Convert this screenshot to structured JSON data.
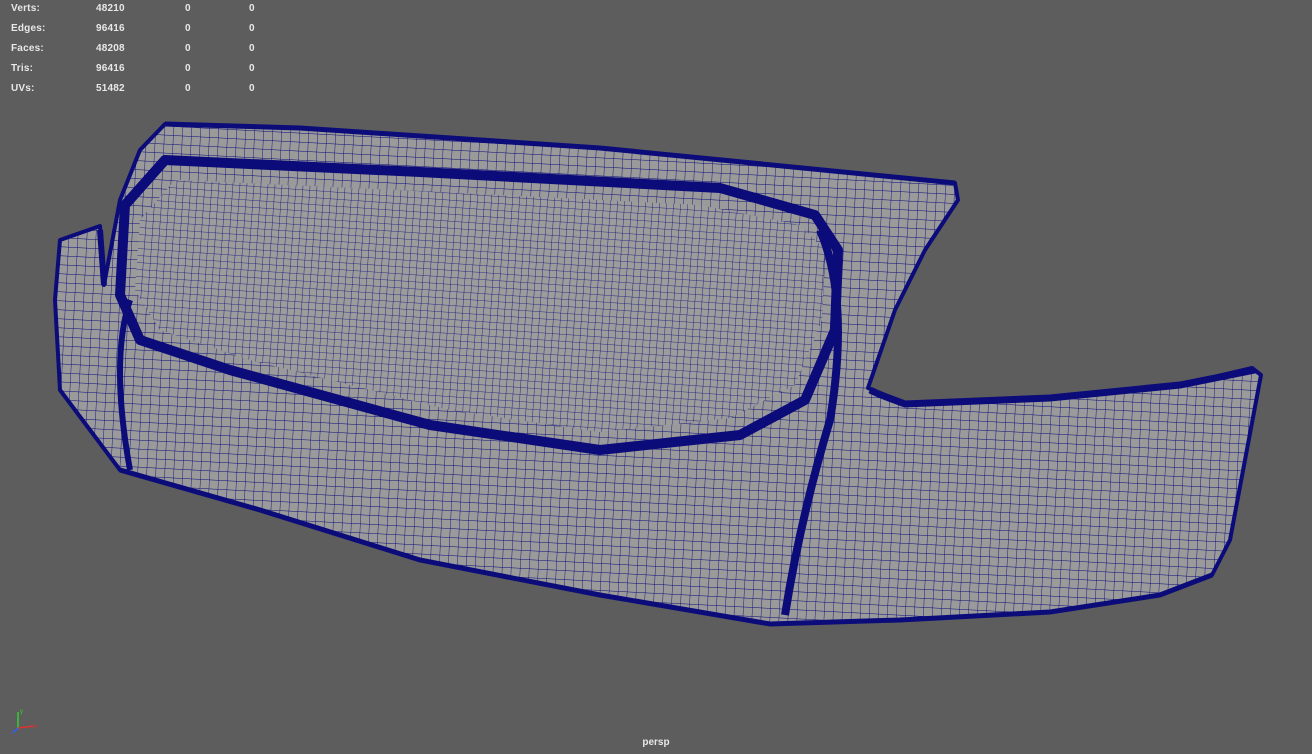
{
  "hud": {
    "rows": [
      {
        "label": "Verts:",
        "total": "48210",
        "selected": "0",
        "component": "0"
      },
      {
        "label": "Edges:",
        "total": "96416",
        "selected": "0",
        "component": "0"
      },
      {
        "label": "Faces:",
        "total": "48208",
        "selected": "0",
        "component": "0"
      },
      {
        "label": "Tris:",
        "total": "96416",
        "selected": "0",
        "component": "0"
      },
      {
        "label": "UVs:",
        "total": "51482",
        "selected": "0",
        "component": "0"
      }
    ]
  },
  "viewport": {
    "camera": "persp",
    "background_color": "#5d5d5d",
    "wireframe_color": "#0b0b7a",
    "surface_color": "#9a9a9a"
  },
  "axis_gizmo": {
    "icon": "xyz-axis-icon",
    "axes": [
      {
        "name": "x",
        "color": "#e03030"
      },
      {
        "name": "y",
        "color": "#30d030"
      },
      {
        "name": "z",
        "color": "#3060ff"
      }
    ]
  }
}
